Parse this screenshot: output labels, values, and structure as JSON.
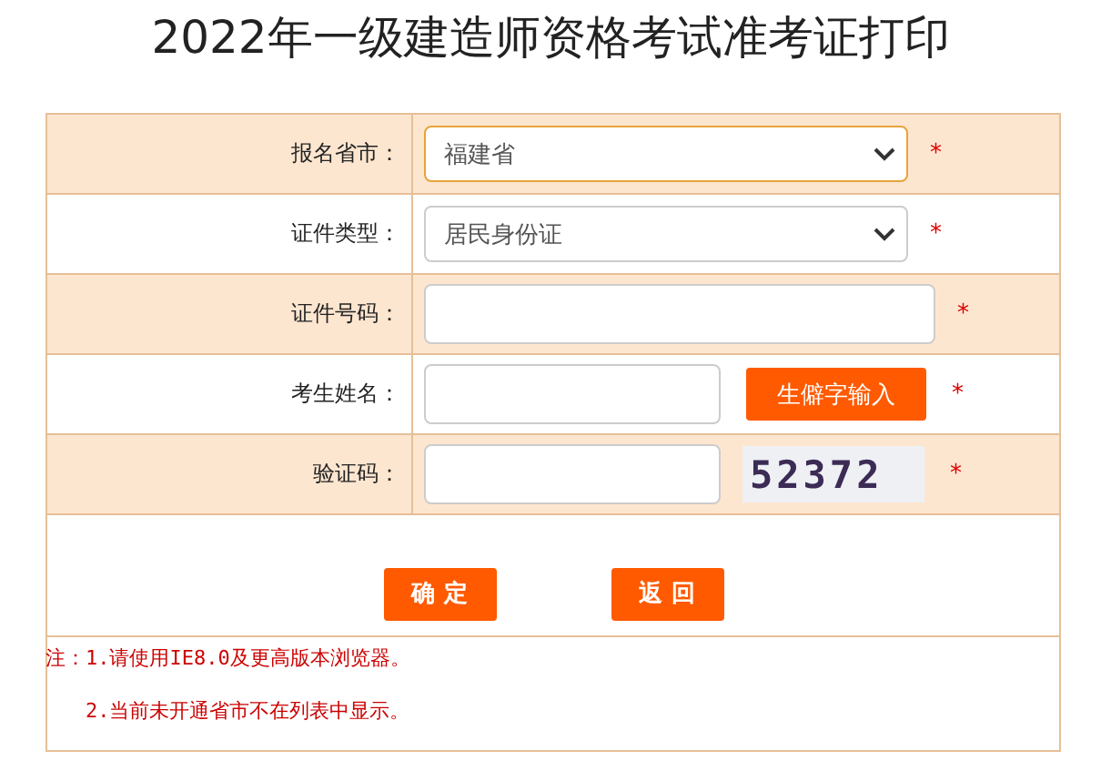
{
  "title": "2022年一级建造师资格考试准考证打印",
  "rows": [
    {
      "label": "报名省市：",
      "kind": "select",
      "value": "福建省",
      "focused": true,
      "mark": "*"
    },
    {
      "label": "证件类型：",
      "kind": "select",
      "value": "居民身份证",
      "focused": false,
      "mark": "*"
    },
    {
      "label": "证件号码：",
      "kind": "input",
      "focused": false,
      "mark": "*"
    },
    {
      "label": "考生姓名：",
      "kind": "input_button",
      "focused": false,
      "button": "生僻字输入",
      "mark": "*"
    },
    {
      "label": "验证码：",
      "kind": "captcha",
      "focused": false,
      "captcha": "52372",
      "mark": "*"
    }
  ],
  "buttons": [
    "确 定",
    "返 回"
  ],
  "notes": [
    "注：1.请使用IE8.0及更高版本浏览器。",
    "2.当前未开通省市不在列表中显示。"
  ]
}
